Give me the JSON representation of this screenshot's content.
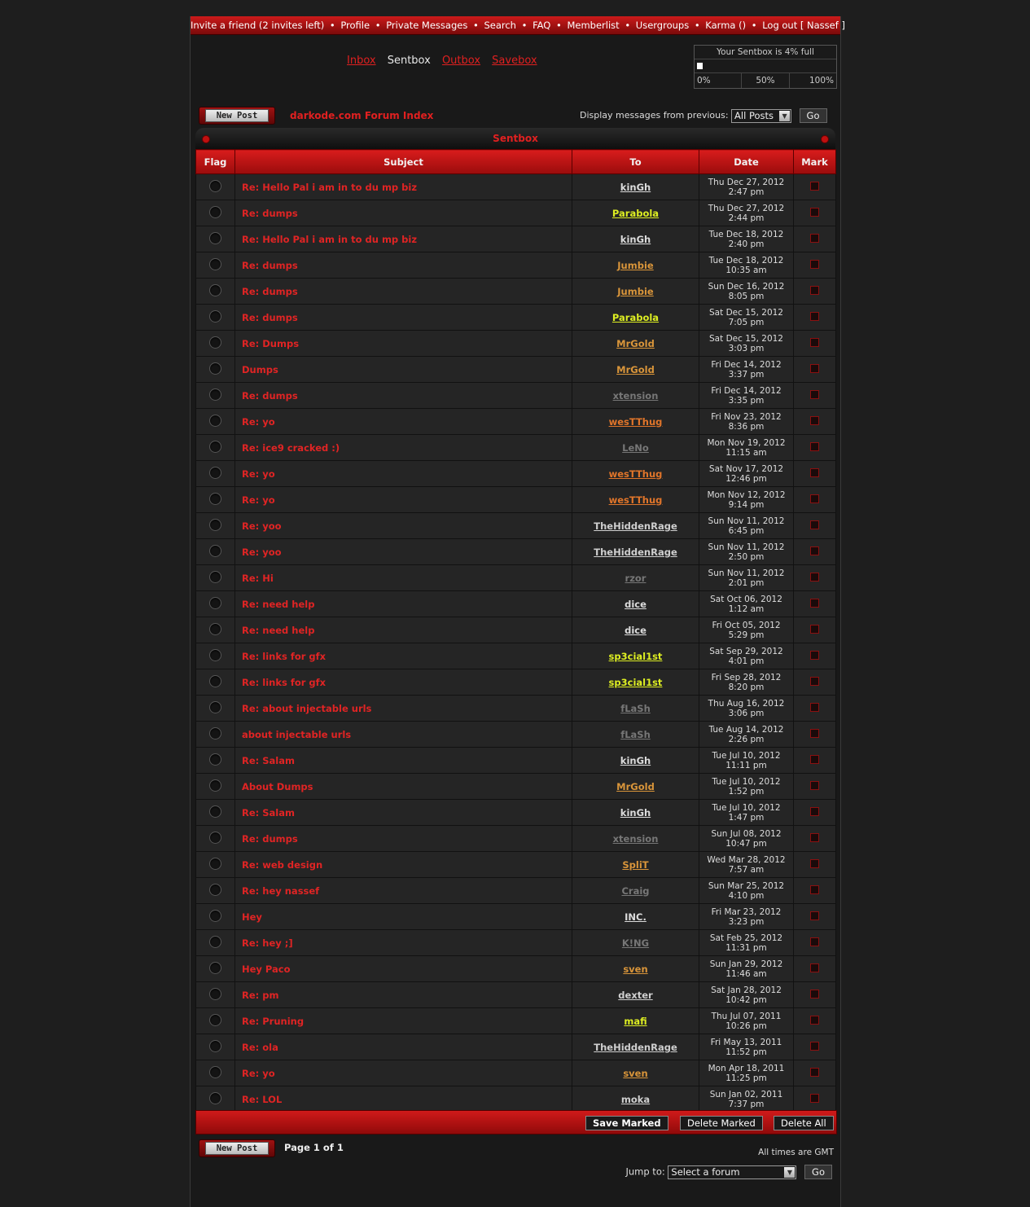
{
  "topnav": {
    "invite": "Invite a friend (2 invites left)",
    "profile": "Profile",
    "private_messages": "Private Messages",
    "search": "Search",
    "faq": "FAQ",
    "memberlist": "Memberlist",
    "usergroups": "Usergroups",
    "karma": "Karma ()",
    "logout": "Log out [ Nassef ]",
    "separator": "•"
  },
  "boxes": {
    "inbox": "Inbox",
    "sentbox": "Sentbox",
    "outbox": "Outbox",
    "savebox": "Savebox"
  },
  "quota": {
    "label": "Your Sentbox is 4% full",
    "percent": 4,
    "scale": [
      "0%",
      "50%",
      "100%"
    ]
  },
  "buttons": {
    "new_post": "New Post",
    "go": "Go",
    "save_marked": "Save Marked",
    "delete_marked": "Delete Marked",
    "delete_all": "Delete All"
  },
  "breadcrumb": "darkode.com Forum Index",
  "display_filter": {
    "label": "Display messages from previous:",
    "value": "All Posts"
  },
  "panel_title": "Sentbox",
  "columns": {
    "flag": "Flag",
    "subject": "Subject",
    "to": "To",
    "date": "Date",
    "mark": "Mark"
  },
  "messages": [
    {
      "subject": "Re: Hello Pal i am in to du mp biz",
      "to": "kinGh",
      "to_color": "#dcdcdc",
      "date1": "Thu Dec 27, 2012",
      "date2": "2:47 pm"
    },
    {
      "subject": "Re: dumps",
      "to": "Parabola",
      "to_color": "#ddee22",
      "date1": "Thu Dec 27, 2012",
      "date2": "2:44 pm"
    },
    {
      "subject": "Re: Hello Pal i am in to du mp biz",
      "to": "kinGh",
      "to_color": "#dcdcdc",
      "date1": "Tue Dec 18, 2012",
      "date2": "2:40 pm"
    },
    {
      "subject": "Re: dumps",
      "to": "Jumbie",
      "to_color": "#d9953a",
      "date1": "Tue Dec 18, 2012",
      "date2": "10:35 am"
    },
    {
      "subject": "Re: dumps",
      "to": "Jumbie",
      "to_color": "#d9953a",
      "date1": "Sun Dec 16, 2012",
      "date2": "8:05 pm"
    },
    {
      "subject": "Re: dumps",
      "to": "Parabola",
      "to_color": "#ddee22",
      "date1": "Sat Dec 15, 2012",
      "date2": "7:05 pm"
    },
    {
      "subject": "Re: Dumps",
      "to": "MrGold",
      "to_color": "#d9953a",
      "date1": "Sat Dec 15, 2012",
      "date2": "3:03 pm"
    },
    {
      "subject": "Dumps",
      "to": "MrGold",
      "to_color": "#d9953a",
      "date1": "Fri Dec 14, 2012",
      "date2": "3:37 pm"
    },
    {
      "subject": "Re: dumps",
      "to": "xtension",
      "to_color": "#777777",
      "date1": "Fri Dec 14, 2012",
      "date2": "3:35 pm"
    },
    {
      "subject": "Re: yo",
      "to": "wesTThug",
      "to_color": "#e0752a",
      "date1": "Fri Nov 23, 2012",
      "date2": "8:36 pm"
    },
    {
      "subject": "Re: ice9 cracked :)",
      "to": "LeNo",
      "to_color": "#777777",
      "date1": "Mon Nov 19, 2012",
      "date2": "11:15 am"
    },
    {
      "subject": "Re: yo",
      "to": "wesTThug",
      "to_color": "#e0752a",
      "date1": "Sat Nov 17, 2012",
      "date2": "12:46 pm"
    },
    {
      "subject": "Re: yo",
      "to": "wesTThug",
      "to_color": "#e0752a",
      "date1": "Mon Nov 12, 2012",
      "date2": "9:14 pm"
    },
    {
      "subject": "Re: yoo",
      "to": "TheHiddenRage",
      "to_color": "#cfcfcf",
      "date1": "Sun Nov 11, 2012",
      "date2": "6:45 pm"
    },
    {
      "subject": "Re: yoo",
      "to": "TheHiddenRage",
      "to_color": "#cfcfcf",
      "date1": "Sun Nov 11, 2012",
      "date2": "2:50 pm"
    },
    {
      "subject": "Re: Hi",
      "to": "rzor",
      "to_color": "#777777",
      "date1": "Sun Nov 11, 2012",
      "date2": "2:01 pm"
    },
    {
      "subject": "Re: need help",
      "to": "dice",
      "to_color": "#dcdcdc",
      "date1": "Sat Oct 06, 2012",
      "date2": "1:12 am"
    },
    {
      "subject": "Re: need help",
      "to": "dice",
      "to_color": "#dcdcdc",
      "date1": "Fri Oct 05, 2012",
      "date2": "5:29 pm"
    },
    {
      "subject": "Re: links for gfx",
      "to": "sp3cial1st",
      "to_color": "#ddee22",
      "date1": "Sat Sep 29, 2012",
      "date2": "4:01 pm"
    },
    {
      "subject": "Re: links for gfx",
      "to": "sp3cial1st",
      "to_color": "#ddee22",
      "date1": "Fri Sep 28, 2012",
      "date2": "8:20 pm"
    },
    {
      "subject": "Re: about injectable urls",
      "to": "fLaSh",
      "to_color": "#777777",
      "date1": "Thu Aug 16, 2012",
      "date2": "3:06 pm"
    },
    {
      "subject": "about injectable urls",
      "to": "fLaSh",
      "to_color": "#777777",
      "date1": "Tue Aug 14, 2012",
      "date2": "2:26 pm"
    },
    {
      "subject": "Re: Salam",
      "to": "kinGh",
      "to_color": "#dcdcdc",
      "date1": "Tue Jul 10, 2012",
      "date2": "11:11 pm"
    },
    {
      "subject": "About Dumps",
      "to": "MrGold",
      "to_color": "#d9953a",
      "date1": "Tue Jul 10, 2012",
      "date2": "1:52 pm"
    },
    {
      "subject": "Re: Salam",
      "to": "kinGh",
      "to_color": "#dcdcdc",
      "date1": "Tue Jul 10, 2012",
      "date2": "1:47 pm"
    },
    {
      "subject": "Re: dumps",
      "to": "xtension",
      "to_color": "#777777",
      "date1": "Sun Jul 08, 2012",
      "date2": "10:47 pm"
    },
    {
      "subject": "Re: web design",
      "to": "SpliT",
      "to_color": "#d9953a",
      "date1": "Wed Mar 28, 2012",
      "date2": "7:57 am"
    },
    {
      "subject": "Re: hey nassef",
      "to": "Craig",
      "to_color": "#777777",
      "date1": "Sun Mar 25, 2012",
      "date2": "4:10 pm"
    },
    {
      "subject": "Hey",
      "to": "INC.",
      "to_color": "#dcdcdc",
      "date1": "Fri Mar 23, 2012",
      "date2": "3:23 pm"
    },
    {
      "subject": "Re: hey ;]",
      "to": "K!NG",
      "to_color": "#777777",
      "date1": "Sat Feb 25, 2012",
      "date2": "11:31 pm"
    },
    {
      "subject": "Hey Paco",
      "to": "sven",
      "to_color": "#d9953a",
      "date1": "Sun Jan 29, 2012",
      "date2": "11:46 am"
    },
    {
      "subject": "Re: pm",
      "to": "dexter",
      "to_color": "#cfcfcf",
      "date1": "Sat Jan 28, 2012",
      "date2": "10:42 pm"
    },
    {
      "subject": "Re: Pruning",
      "to": "mafi",
      "to_color": "#ddee22",
      "date1": "Thu Jul 07, 2011",
      "date2": "10:26 pm"
    },
    {
      "subject": "Re: ola",
      "to": "TheHiddenRage",
      "to_color": "#cfcfcf",
      "date1": "Fri May 13, 2011",
      "date2": "11:52 pm"
    },
    {
      "subject": "Re: yo",
      "to": "sven",
      "to_color": "#d9953a",
      "date1": "Mon Apr 18, 2011",
      "date2": "11:25 pm"
    },
    {
      "subject": "Re: LOL",
      "to": "moka",
      "to_color": "#cfcfcf",
      "date1": "Sun Jan 02, 2011",
      "date2": "7:37 pm"
    }
  ],
  "pagination": "Page 1 of 1",
  "timezone": "All times are GMT",
  "jump": {
    "label": "Jump to:",
    "value": "Select a forum"
  },
  "colors": {
    "accent": "#cc1a1a",
    "link": "#e02020",
    "background": "#1e1e1e"
  }
}
